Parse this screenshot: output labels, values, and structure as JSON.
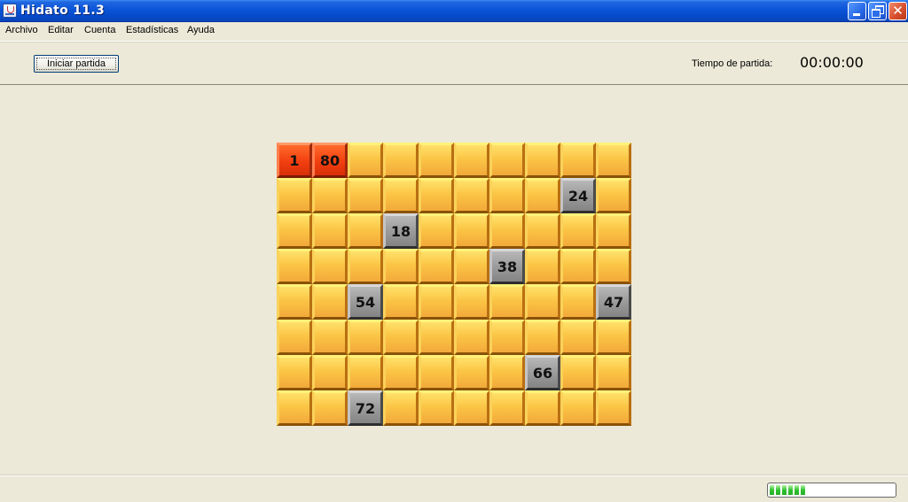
{
  "window": {
    "title": "Hidato 11.3",
    "minimize_icon": "minimize-icon",
    "maximize_icon": "restore-icon",
    "close_icon": "close-icon",
    "close_glyph": "✕"
  },
  "menu": {
    "items": [
      "Archivo",
      "Editar",
      "Cuenta",
      "Estadísticas",
      "Ayuda"
    ]
  },
  "toolbar": {
    "start_label": "Iniciar partida",
    "time_label": "Tiempo de partida:",
    "time_value": "00:00:00"
  },
  "board": {
    "rows": 8,
    "cols": 10,
    "cells": [
      {
        "row": 0,
        "col": 0,
        "value": "1",
        "kind": "endpoint"
      },
      {
        "row": 0,
        "col": 1,
        "value": "80",
        "kind": "endpoint"
      },
      {
        "row": 1,
        "col": 8,
        "value": "24",
        "kind": "fixed"
      },
      {
        "row": 2,
        "col": 3,
        "value": "18",
        "kind": "fixed"
      },
      {
        "row": 3,
        "col": 6,
        "value": "38",
        "kind": "fixed"
      },
      {
        "row": 4,
        "col": 2,
        "value": "54",
        "kind": "fixed"
      },
      {
        "row": 4,
        "col": 9,
        "value": "47",
        "kind": "fixed"
      },
      {
        "row": 6,
        "col": 7,
        "value": "66",
        "kind": "fixed"
      },
      {
        "row": 7,
        "col": 2,
        "value": "72",
        "kind": "fixed"
      }
    ],
    "colors": {
      "empty": "#FBC545",
      "fixed": "#9B9B9B",
      "endpoint": "#F23F10"
    }
  },
  "status": {
    "progress_blocks": 6,
    "progress_color": "#2FC22F"
  }
}
